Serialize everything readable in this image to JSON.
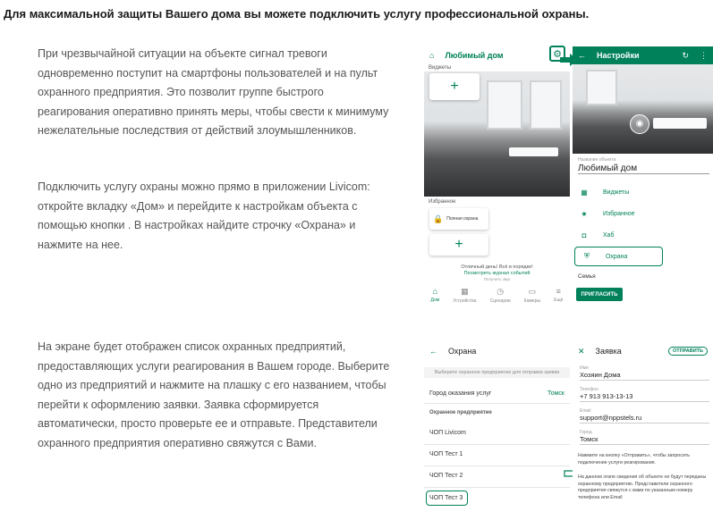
{
  "heading": "Для максимальной защиты Вашего дома вы можете подключить услугу профессиональной охраны.",
  "paragraphs": {
    "p1": "При чрезвычайной ситуации на объекте сигнал тревоги одновременно поступит на смартфоны пользователей и на пульт охранного предприятия. Это позволит группе быстрого реагирования оперативно принять меры, чтобы свести к минимуму нежелательные последствия от действий злоумышленников.",
    "p2": "Подключить услугу охраны можно прямо в приложении Livicom: откройте вкладку «Дом» и перейдите к настройкам объекта с помощью кнопки . В настройках найдите строчку «Охрана» и нажмите на нее.",
    "p3": "На экране будет отображен список охранных предприятий, предоставляющих услуги реагирования в Вашем городе. Выберите одно из предприятий и нажмите на плашку с его названием, чтобы перейти к оформлению заявки. Заявка сформируется автоматически, просто проверьте ее и отправьте. Представители охранного предприятия оперативно свяжутся с Вами."
  },
  "home_screen": {
    "title": "Любимый дом",
    "widgets_label": "Виджеты",
    "favorites_label": "Избранное",
    "fav_card": "Полная охрана",
    "status_line1": "Отличный день! Всё в порядке!",
    "status_link": "Посмотреть журнал событий",
    "status_line3": "Получить звук",
    "tabs": [
      "Дом",
      "Устройства",
      "Сценарии",
      "Камеры",
      "Ещё"
    ]
  },
  "settings_screen": {
    "title": "Настройки",
    "name_label": "Название объекта",
    "name_value": "Любимый дом",
    "menu": [
      "Виджеты",
      "Избранное",
      "Хаб",
      "Охрана"
    ],
    "family_label": "Семья",
    "invite_button": "ПРИГЛАСИТЬ"
  },
  "security_screen": {
    "title": "Охрана",
    "hint": "Выберите охранное предприятие для отправки заявки",
    "city_label": "Город оказания услуг",
    "city_value": "Томск",
    "section": "Охранное предприятие",
    "companies": [
      "ЧОП Livicom",
      "ЧОП Тест 1",
      "ЧОП Тест 2",
      "ЧОП Тест 3"
    ]
  },
  "request_screen": {
    "title": "Заявка",
    "send_button": "ОТПРАВИТЬ",
    "fields": [
      {
        "label": "Имя",
        "value": "Хозяин Дома"
      },
      {
        "label": "Телефон",
        "value": "+7 913 913-13-13"
      },
      {
        "label": "Email",
        "value": "support@nppstels.ru"
      },
      {
        "label": "Город",
        "value": "Томск"
      }
    ],
    "note1": "Нажмите на кнопку «Отправить», чтобы запросить подключение услуги реагирования.",
    "note2": "На данном этапе сведения об объекте не будут переданы охранному предприятию. Представители охранного предприятия свяжутся с вами по указанным номеру телефона или Email"
  },
  "colors": {
    "brand": "#00815a",
    "text": "#555555",
    "heading": "#1a1a1a"
  }
}
